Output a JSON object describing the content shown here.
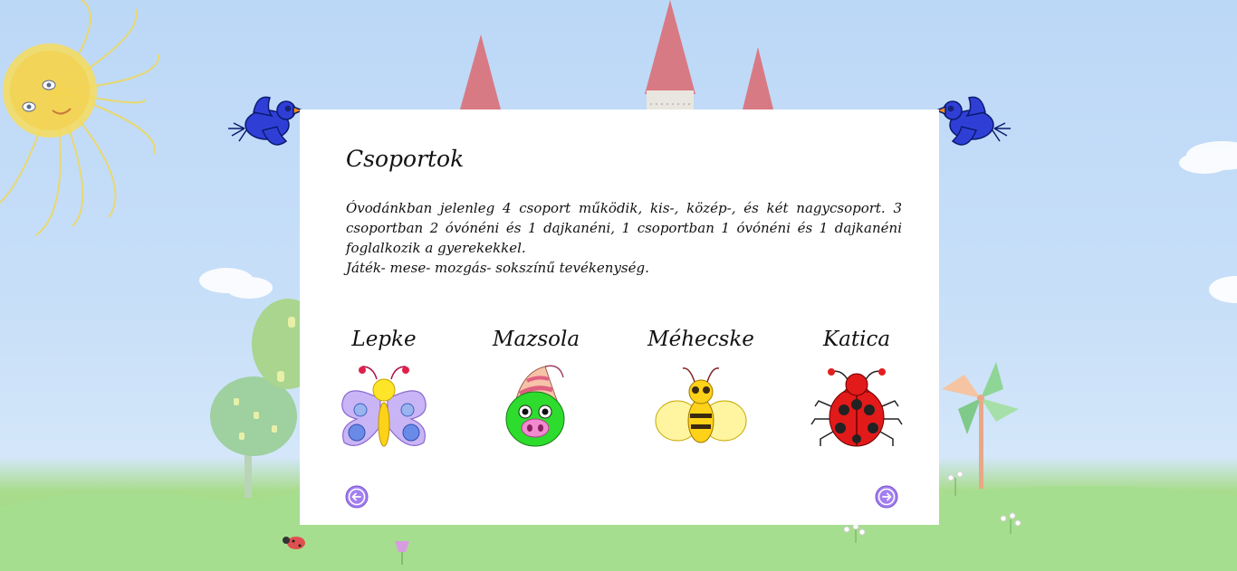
{
  "page": {
    "heading": "Csoportok",
    "intro_line_1": "Óvodánkban jelenleg 4 csoport működik, kis-, közép-, és két nagycsoport. 3 csoportban 2 óvónéni és 1 dajkanéni, 1 csoportban 1 óvónéni és 1 dajkanéni foglalkozik a gyerekekkel.",
    "intro_line_2": "Játék- mese- mozgás- sokszínű tevékenység."
  },
  "groups": [
    {
      "name": "Lepke",
      "icon": "butterfly-icon"
    },
    {
      "name": "Mazsola",
      "icon": "pig-icon"
    },
    {
      "name": "Méhecske",
      "icon": "bee-icon"
    },
    {
      "name": "Katica",
      "icon": "ladybug-icon"
    }
  ],
  "nav": {
    "prev_icon": "arrow-left-icon",
    "next_icon": "arrow-right-icon"
  },
  "colors": {
    "sky": "#bcd8f7",
    "grass": "#9fd783",
    "nav_button": "#a37ef0",
    "panel": "#ffffff"
  }
}
